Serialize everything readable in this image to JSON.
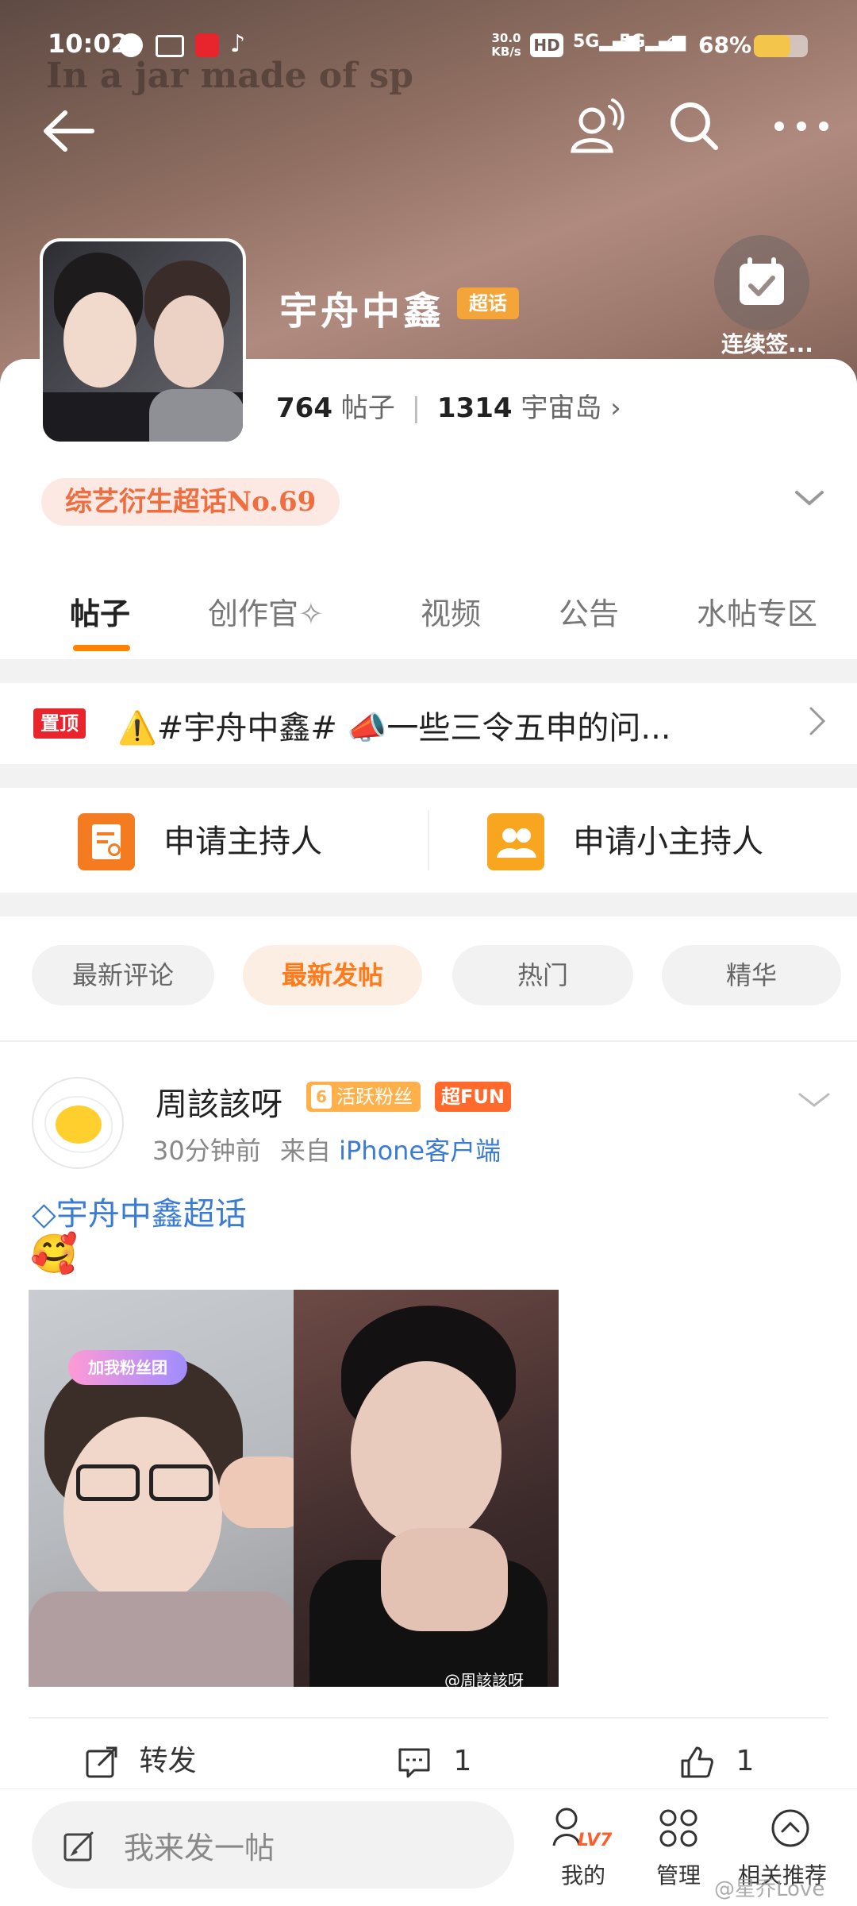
{
  "status_bar": {
    "time": "10:02",
    "overlay_text": "In a jar made of sp",
    "net_speed_value": "30.0",
    "net_speed_unit": "KB/s",
    "signal1": "5G",
    "signal2": "5G",
    "battery": "68%",
    "battery_level": 0.68
  },
  "topbar": {
    "back_icon": "back-arrow-icon",
    "follow_icon": "user-follow-icon",
    "search_icon": "search-icon",
    "more_icon": "more-icon"
  },
  "header": {
    "title": "宇舟中鑫",
    "badge": "超话",
    "signin_label": "连续签...",
    "posts_count": "764",
    "posts_label": "帖子",
    "members_count": "1314",
    "members_label": "宇宙岛",
    "rank": "综艺衍生超话No.69"
  },
  "tabs": [
    "帖子",
    "创作官",
    "视频",
    "公告",
    "水帖专区"
  ],
  "pinned": {
    "badge": "置顶",
    "text": "⚠️#宇舟中鑫# 📣一些三令五申的问..."
  },
  "apply": {
    "host": "申请主持人",
    "sub_host": "申请小主持人"
  },
  "filters": [
    "最新评论",
    "最新发帖",
    "热门",
    "精华"
  ],
  "post": {
    "username": "周該該呀",
    "fan_badge_level": "6",
    "fan_badge": "活跃粉丝",
    "fun_badge": "超FUN",
    "time": "30分钟前",
    "source_prefix": "来自",
    "source": "iPhone客户端",
    "topic": "宇舟中鑫超话",
    "emoji": "🥰",
    "sticker": "加我粉丝团",
    "watermark": "@周該該呀",
    "repost_label": "转发",
    "comment_count": "1",
    "like_count": "1"
  },
  "bottom_bar": {
    "compose_placeholder": "我来发一帖",
    "level": "LV7",
    "mine": "我的",
    "manage": "管理",
    "related": "相关推荐",
    "corner_watermark": "@星乔Love"
  },
  "colors": {
    "accent": "#ff8200",
    "link": "#3a7bd5",
    "pinned_red": "#e8252d",
    "rank_text": "#ef6d3f"
  }
}
